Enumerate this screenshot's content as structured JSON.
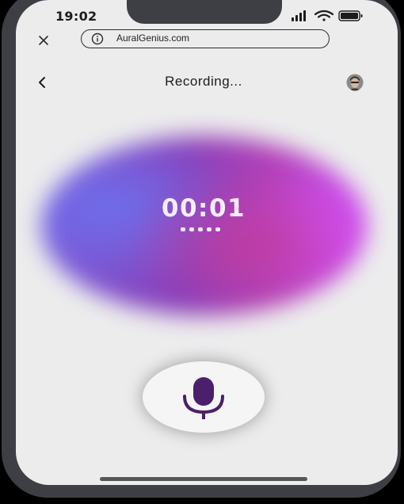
{
  "status_bar": {
    "time": "19:02",
    "icons": [
      "signal-icon",
      "wifi-icon",
      "battery-icon"
    ]
  },
  "browser": {
    "url": "AuralGenius.com",
    "close_icon": "close-icon",
    "info_icon": "info-icon"
  },
  "header": {
    "title": "Recording...",
    "back_icon": "chevron-left-icon",
    "avatar": "user-avatar"
  },
  "recorder": {
    "timer": "00:01",
    "level_dots": 5,
    "mic_icon": "microphone-icon"
  },
  "colors": {
    "accent": "#4a1f6b",
    "orb_blue": "#6e6eeb",
    "orb_magenta": "#c84fe8",
    "background": "#ececed",
    "frame": "#3d3f45"
  }
}
